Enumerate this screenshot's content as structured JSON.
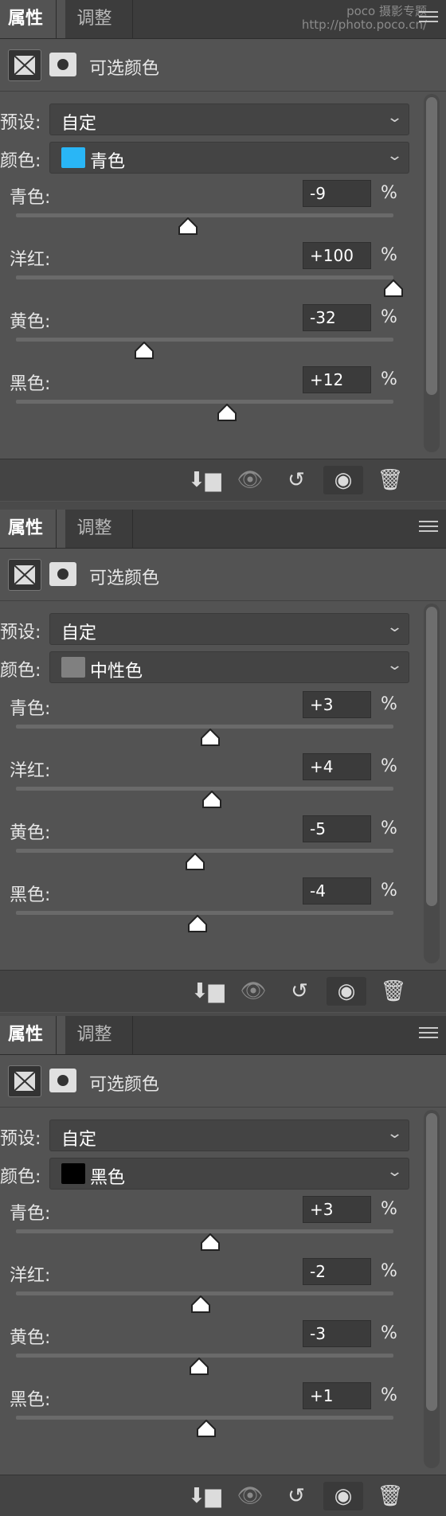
{
  "panels": [
    {
      "tab_active": "属性",
      "tab_inactive": "调整",
      "watermark_line1": "poco 摄影专题",
      "watermark_line2": "http://photo.poco.cn/",
      "title": "可选颜色",
      "preset_label": "预设:",
      "preset_value": "自定",
      "color_label": "颜色:",
      "color_value": "青色",
      "swatch_color": "#29b6f6",
      "sliders": [
        {
          "label": "青色:",
          "value": "-9",
          "unit": "%",
          "level": -9
        },
        {
          "label": "洋红:",
          "value": "+100",
          "unit": "%",
          "level": 100
        },
        {
          "label": "黄色:",
          "value": "-32",
          "unit": "%",
          "level": -32
        },
        {
          "label": "黑色:",
          "value": "+12",
          "unit": "%",
          "level": 12
        }
      ],
      "footer_icons": [
        "clip-to-layer-icon",
        "view-previous-icon",
        "reset-icon",
        "visibility-eye-icon",
        "trash-icon"
      ]
    },
    {
      "tab_active": "属性",
      "tab_inactive": "调整",
      "title": "可选颜色",
      "preset_label": "预设:",
      "preset_value": "自定",
      "color_label": "颜色:",
      "color_value": "中性色",
      "swatch_color": "#808080",
      "sliders": [
        {
          "label": "青色:",
          "value": "+3",
          "unit": "%",
          "level": 3
        },
        {
          "label": "洋红:",
          "value": "+4",
          "unit": "%",
          "level": 4
        },
        {
          "label": "黄色:",
          "value": "-5",
          "unit": "%",
          "level": -5
        },
        {
          "label": "黑色:",
          "value": "-4",
          "unit": "%",
          "level": -4
        }
      ],
      "footer_icons": [
        "clip-to-layer-icon",
        "view-previous-icon",
        "reset-icon",
        "visibility-eye-icon",
        "trash-icon"
      ]
    },
    {
      "tab_active": "属性",
      "tab_inactive": "调整",
      "title": "可选颜色",
      "preset_label": "预设:",
      "preset_value": "自定",
      "color_label": "颜色:",
      "color_value": "黑色",
      "swatch_color": "#000000",
      "sliders": [
        {
          "label": "青色:",
          "value": "+3",
          "unit": "%",
          "level": 3
        },
        {
          "label": "洋红:",
          "value": "-2",
          "unit": "%",
          "level": -2
        },
        {
          "label": "黄色:",
          "value": "-3",
          "unit": "%",
          "level": -3
        },
        {
          "label": "黑色:",
          "value": "+1",
          "unit": "%",
          "level": 1
        }
      ],
      "footer_icons": [
        "clip-to-layer-icon",
        "view-previous-icon",
        "reset-icon",
        "visibility-eye-icon",
        "trash-icon"
      ]
    }
  ],
  "colors": {
    "panel_bg": "#535353",
    "tabbar_bg": "#3c3c3c",
    "input_bg": "#3b3b3b",
    "text": "#e6e6e6"
  }
}
